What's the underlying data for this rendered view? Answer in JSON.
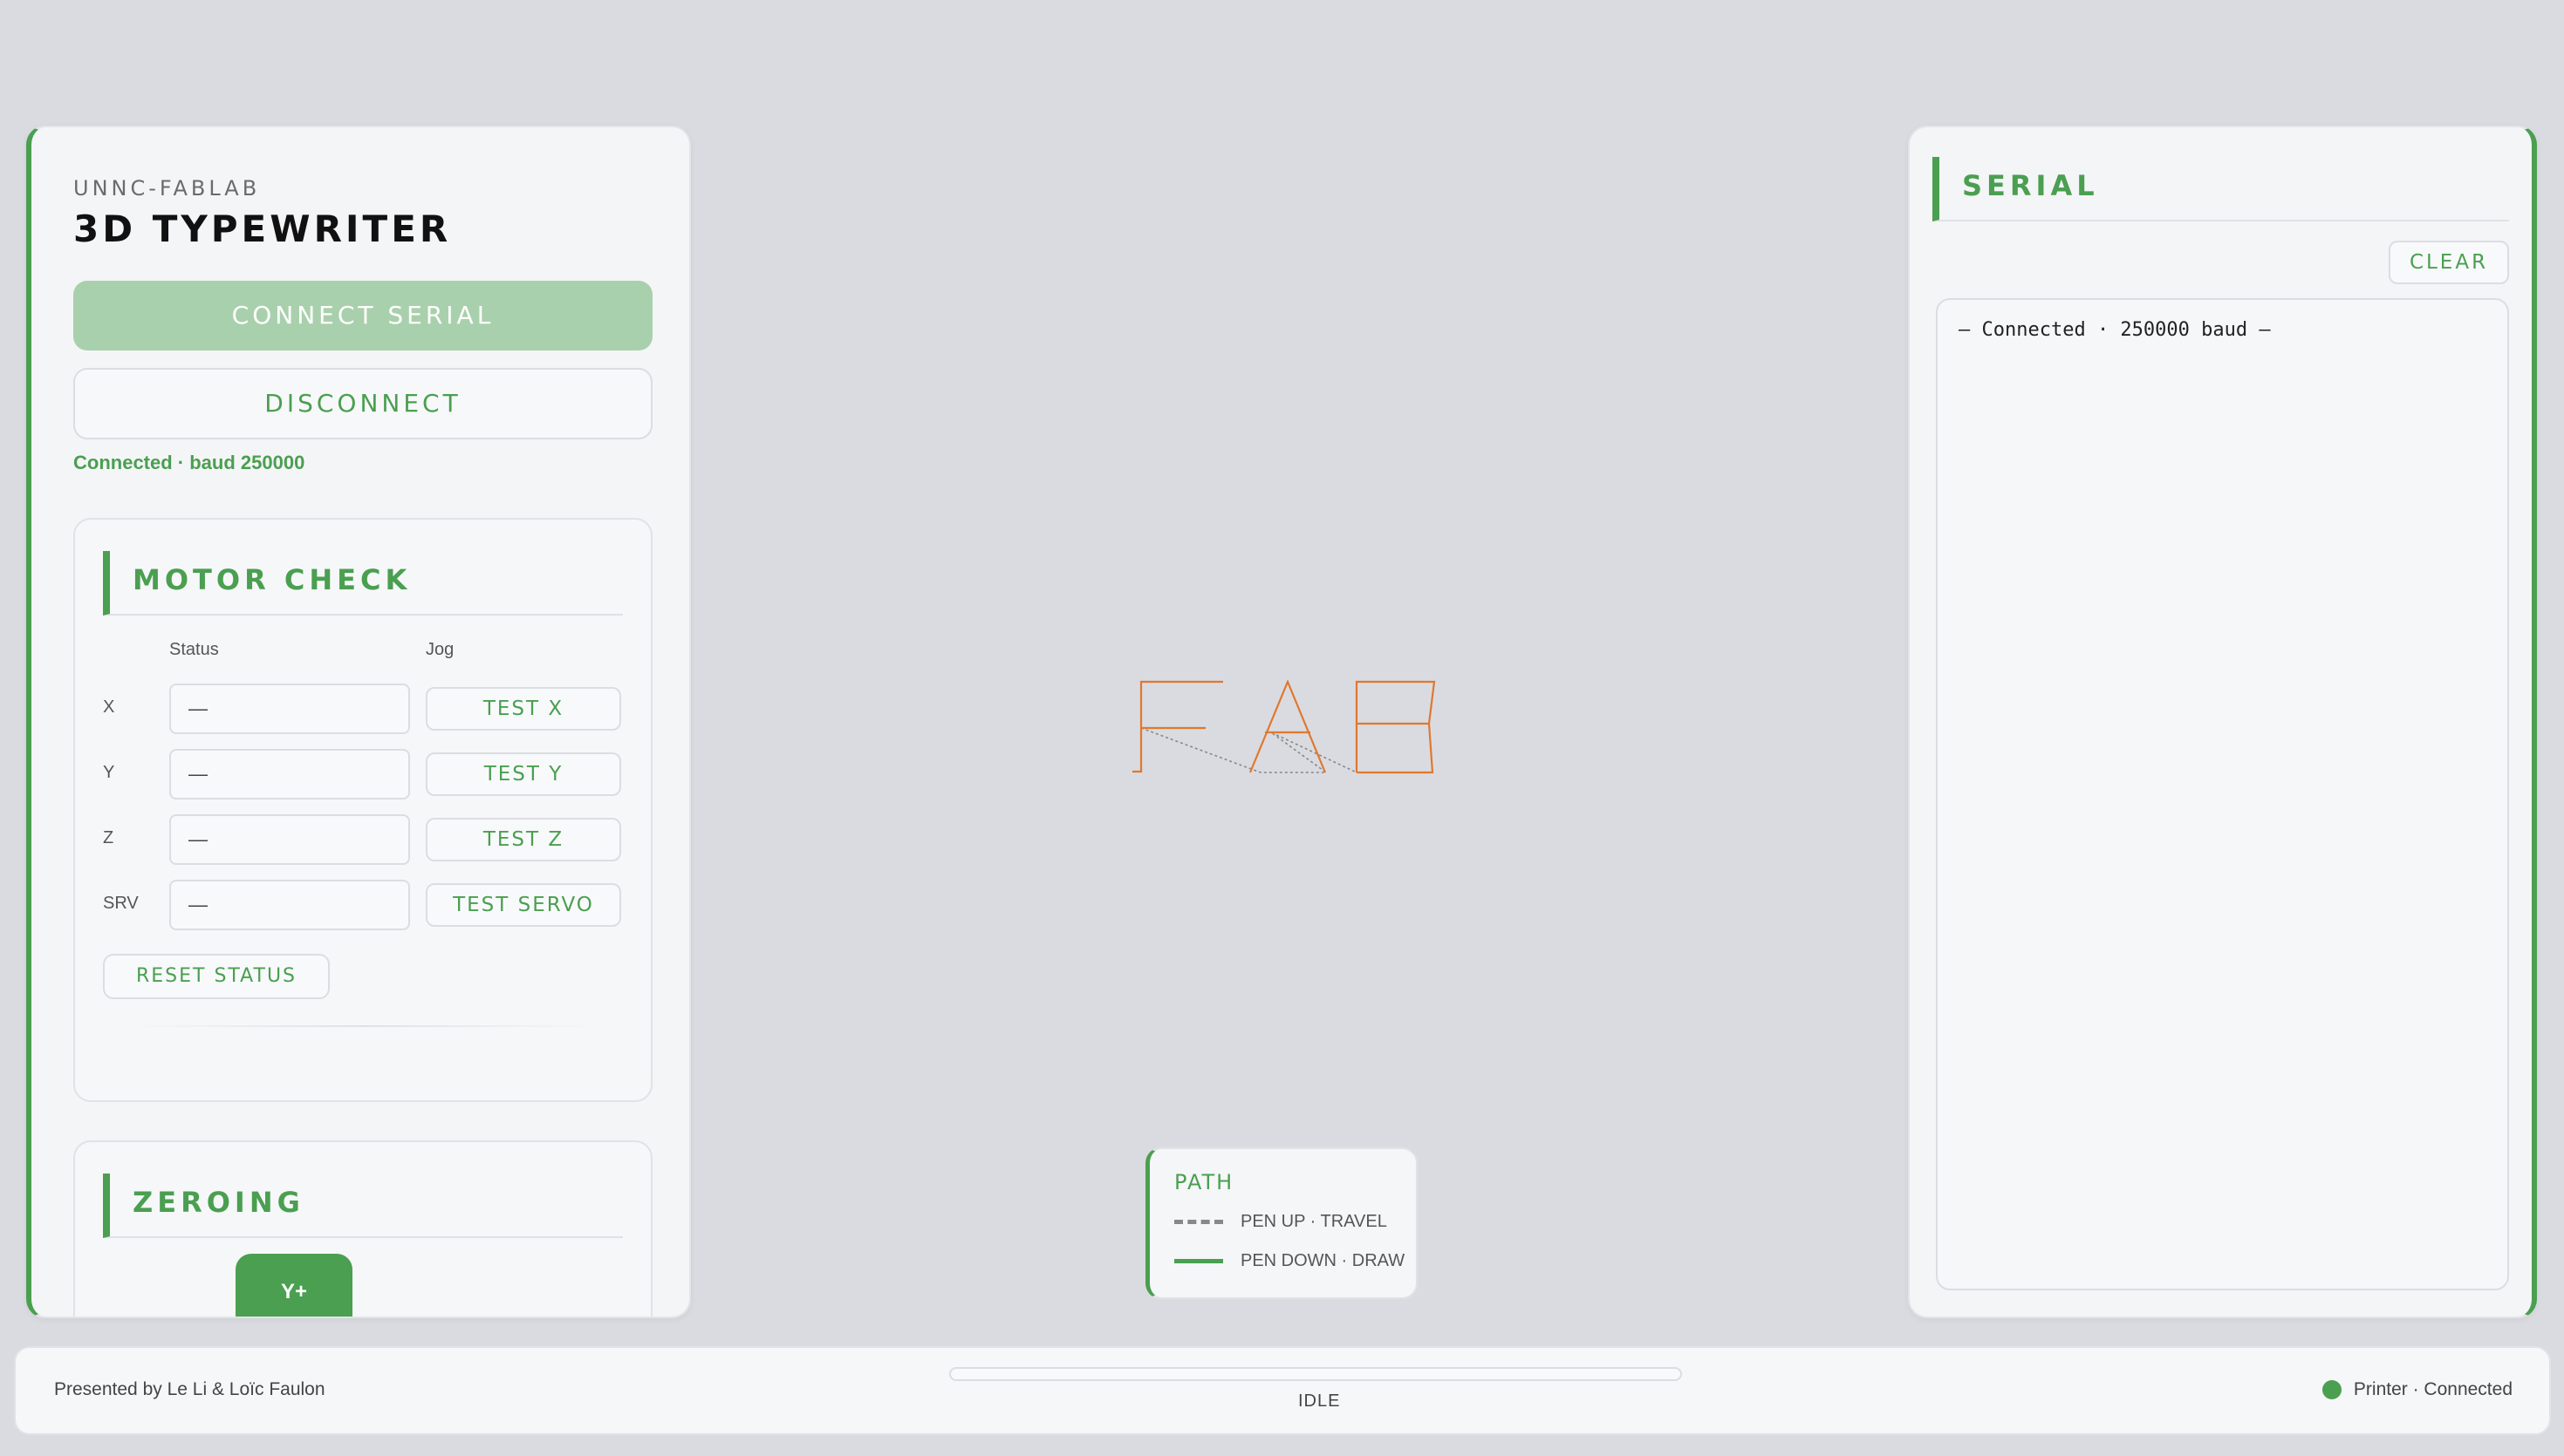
{
  "sidebar": {
    "org": "UNNC-FABLAB",
    "title": "3D TYPEWRITER",
    "connect_label": "CONNECT SERIAL",
    "disconnect_label": "DISCONNECT",
    "connection_status": "Connected · baud 250000"
  },
  "motor_check": {
    "title": "MOTOR CHECK",
    "status_header": "Status",
    "jog_header": "Jog",
    "rows": [
      {
        "axis": "X",
        "status": "—",
        "button": "TEST X"
      },
      {
        "axis": "Y",
        "status": "—",
        "button": "TEST Y"
      },
      {
        "axis": "Z",
        "status": "—",
        "button": "TEST Z"
      },
      {
        "axis": "SRV",
        "status": "—",
        "button": "TEST SERVO"
      }
    ],
    "reset_label": "RESET STATUS"
  },
  "zeroing": {
    "title": "ZEROING",
    "y_plus_label": "Y+"
  },
  "serial": {
    "title": "SERIAL",
    "clear_label": "CLEAR",
    "log": [
      "— Connected · 250000 baud —"
    ]
  },
  "canvas": {
    "preview_text": "FAB",
    "draw_color": "#e0782e",
    "travel_color": "#888888"
  },
  "path_legend": {
    "title": "PATH",
    "pen_up": "PEN UP · TRAVEL",
    "pen_down": "PEN DOWN · DRAW"
  },
  "footer": {
    "credit": "Presented by Le Li & Loïc Faulon",
    "job_status": "IDLE",
    "progress": 0,
    "printer_status": "Printer · Connected"
  },
  "colors": {
    "accent": "#4a9f50",
    "accent_light": "#a9d0ac",
    "background": "#dadbe0"
  }
}
